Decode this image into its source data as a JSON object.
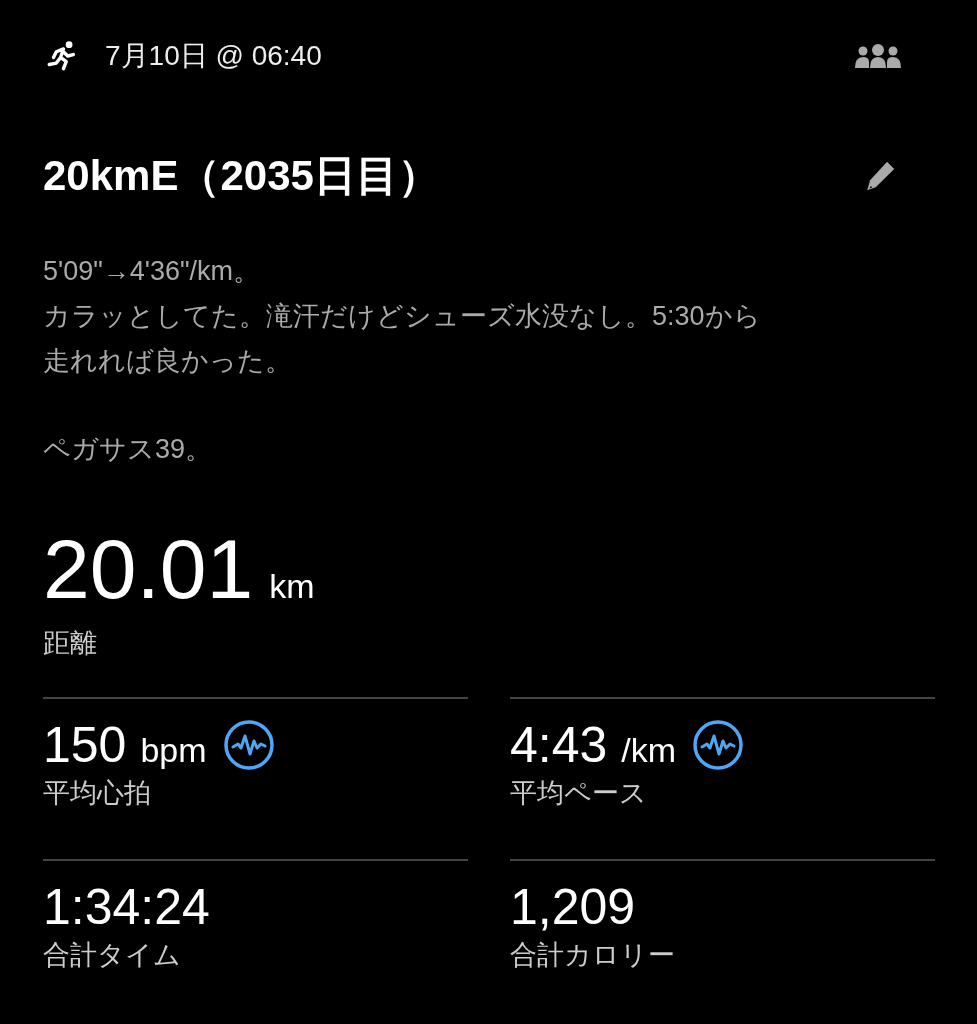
{
  "header": {
    "datetime": "7月10日 @ 06:40"
  },
  "title": "20kmE（2035日目）",
  "description_lines": [
    "5'09\"→4'36\"/km。",
    "カラッとしてた。滝汗だけどシューズ水没なし。5:30から",
    "走れれば良かった。"
  ],
  "note": "ペガサス39。",
  "distance": {
    "value": "20.01",
    "unit": "km",
    "label": "距離"
  },
  "stats": [
    {
      "value": "150",
      "unit": "bpm",
      "label": "平均心拍",
      "analysis": true
    },
    {
      "value": "4:43",
      "unit": "/km",
      "label": "平均ペース",
      "analysis": true
    },
    {
      "value": "1:34:24",
      "label": "合計タイム",
      "analysis": false
    },
    {
      "value": "1,209",
      "label": "合計カロリー",
      "analysis": false
    }
  ]
}
